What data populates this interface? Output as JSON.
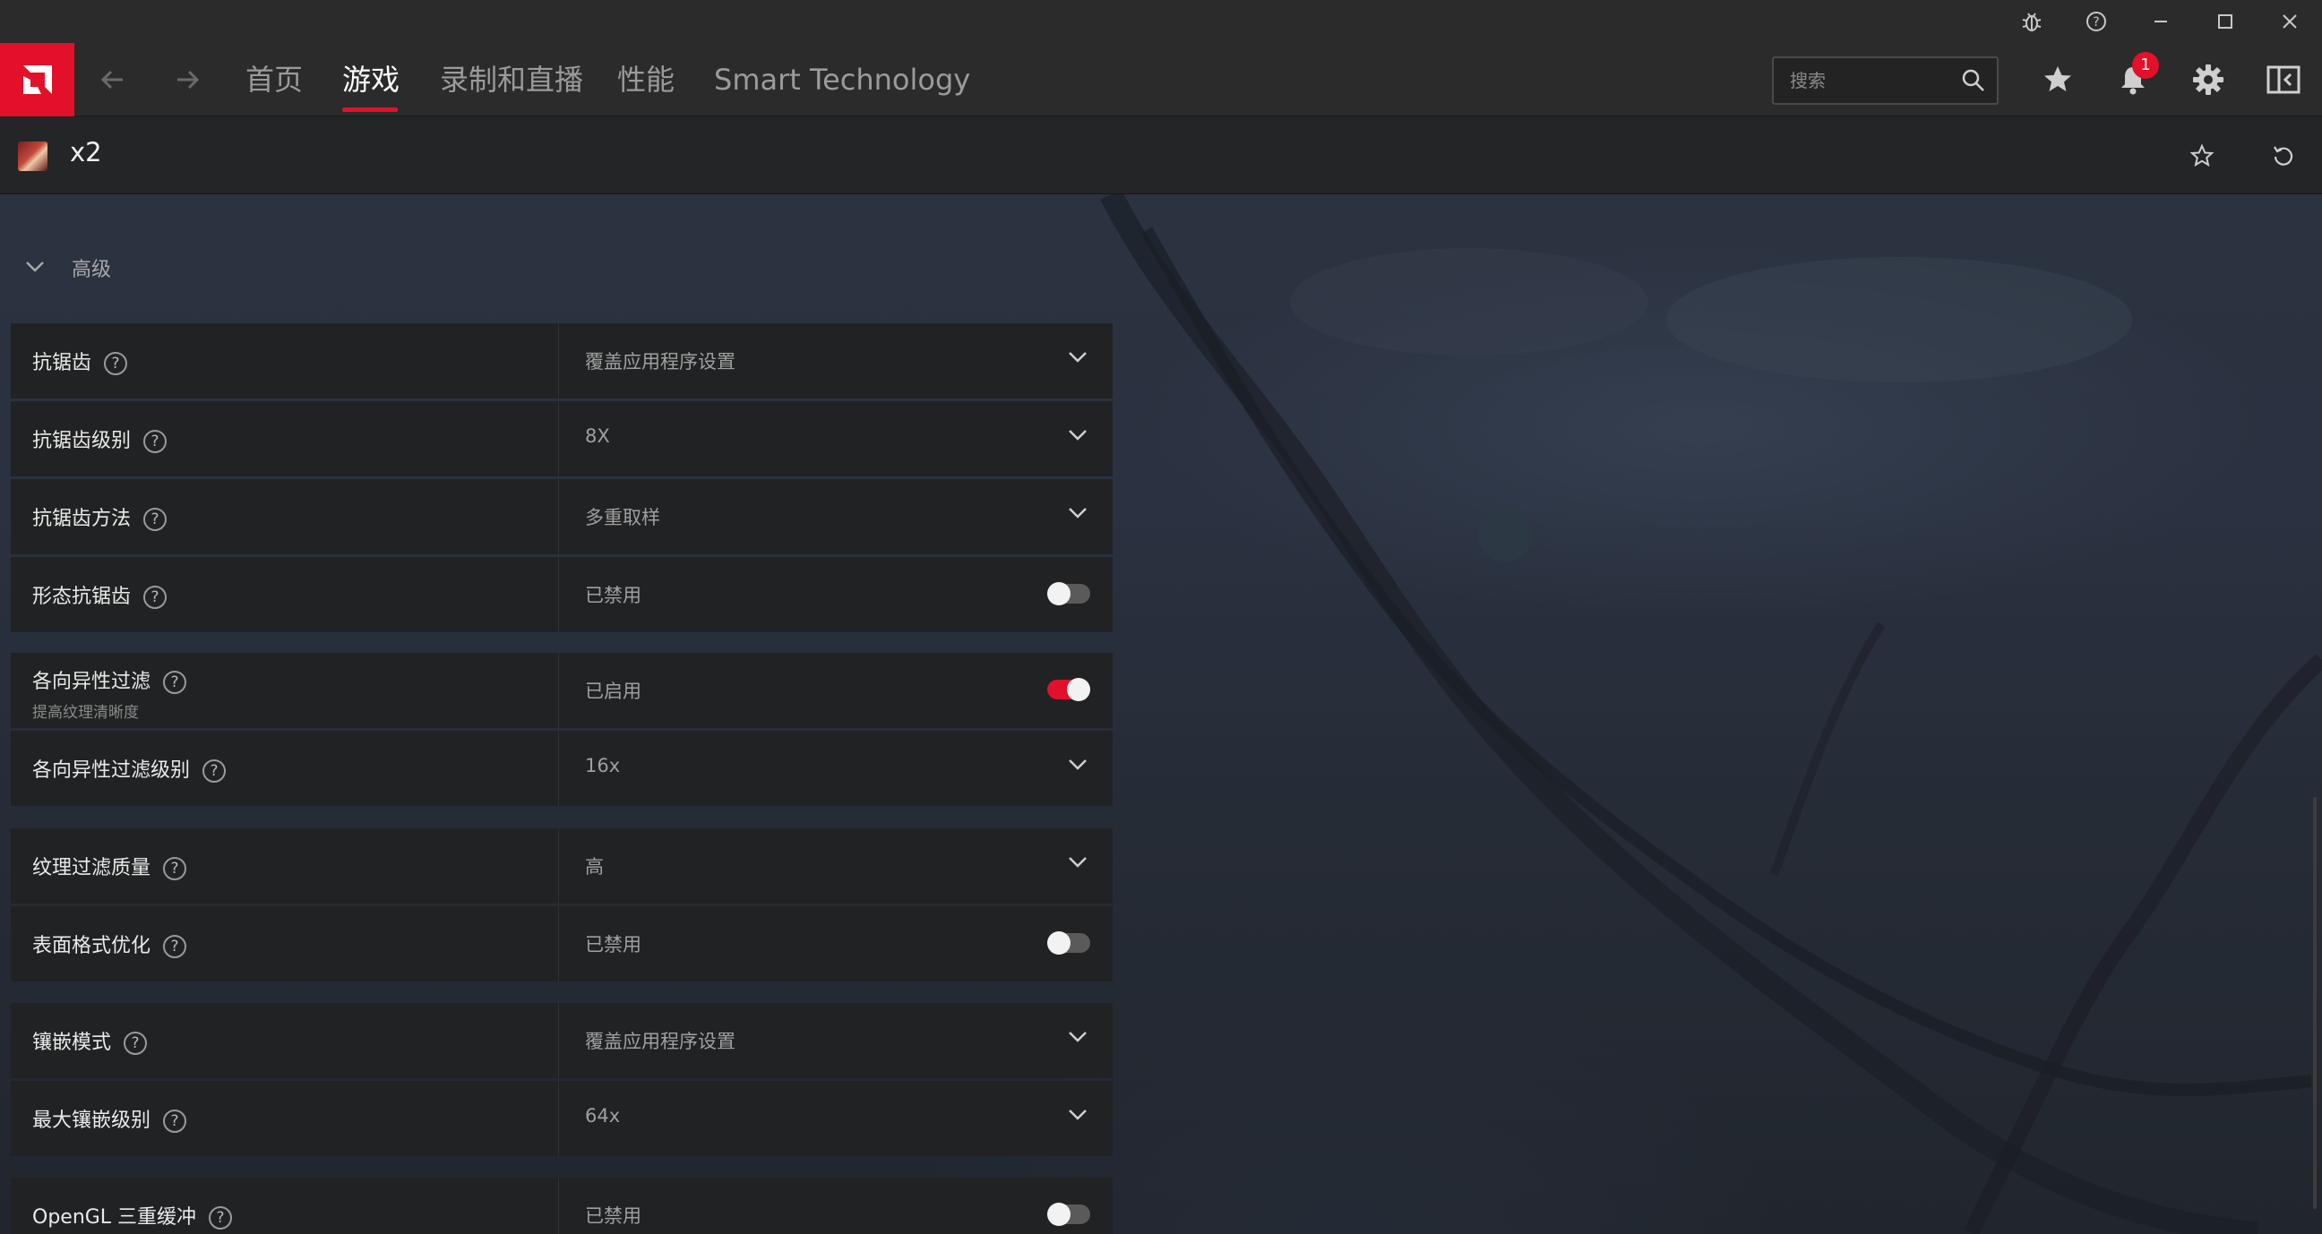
{
  "window": {
    "buttons": [
      "bug-icon",
      "help-icon",
      "minimize-icon",
      "maximize-icon",
      "close-icon"
    ]
  },
  "nav": {
    "tabs": [
      {
        "label": "首页",
        "active": false
      },
      {
        "label": "游戏",
        "active": true
      },
      {
        "label": "录制和直播",
        "active": false
      },
      {
        "label": "性能",
        "active": false
      },
      {
        "label": "Smart Technology",
        "active": false
      }
    ],
    "search": {
      "placeholder": "搜索",
      "value": ""
    },
    "notification_count": "1"
  },
  "game": {
    "title": "x2"
  },
  "section": {
    "title": "高级"
  },
  "settings": [
    {
      "label": "抗锯齿",
      "sub": "",
      "value": "覆盖应用程序设置",
      "control": "dropdown"
    },
    {
      "label": "抗锯齿级别",
      "sub": "",
      "value": "8X",
      "control": "dropdown"
    },
    {
      "label": "抗锯齿方法",
      "sub": "",
      "value": "多重取样",
      "control": "dropdown"
    },
    {
      "label": "形态抗锯齿",
      "sub": "",
      "value": "已禁用",
      "control": "toggle",
      "on": false
    },
    {
      "label": "各向异性过滤",
      "sub": "提高纹理清晰度",
      "value": "已启用",
      "control": "toggle",
      "on": true
    },
    {
      "label": "各向异性过滤级别",
      "sub": "",
      "value": "16x",
      "control": "dropdown"
    },
    {
      "label": "纹理过滤质量",
      "sub": "",
      "value": "高",
      "control": "dropdown"
    },
    {
      "label": "表面格式优化",
      "sub": "",
      "value": "已禁用",
      "control": "toggle",
      "on": false
    },
    {
      "label": "镶嵌模式",
      "sub": "",
      "value": "覆盖应用程序设置",
      "control": "dropdown"
    },
    {
      "label": "最大镶嵌级别",
      "sub": "",
      "value": "64x",
      "control": "dropdown"
    },
    {
      "label": "OpenGL 三重缓冲",
      "sub": "",
      "value": "已禁用",
      "control": "toggle",
      "on": false
    }
  ],
  "colors": {
    "accent": "#e3102a",
    "panel": "#212223",
    "topbar": "#2b2b2b"
  }
}
